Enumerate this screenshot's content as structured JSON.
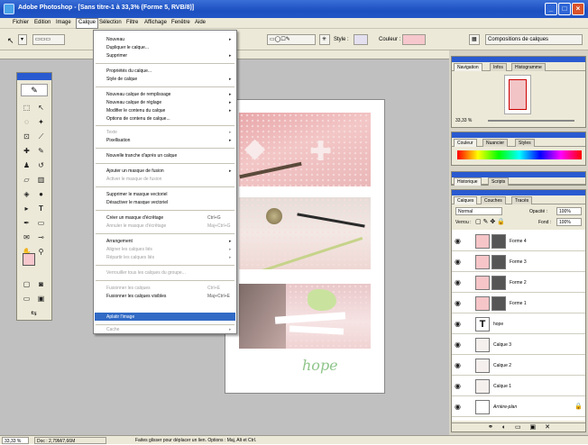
{
  "window": {
    "title": "Adobe Photoshop - [Sans titre-1 à 33,3% (Forme 5, RVB/8)]"
  },
  "window_controls": {
    "minimize": "_",
    "maximize": "□",
    "close": "×"
  },
  "menubar": [
    "Fichier",
    "Edition",
    "Image",
    "Calque",
    "Sélection",
    "Filtre",
    "Affichage",
    "Fenêtre",
    "Aide"
  ],
  "options_bar": {
    "style_label": "Style :",
    "color_label": "Couleur :",
    "layer_comps": "Compositions de calques"
  },
  "layer_menu": {
    "items": [
      {
        "label": "Nouveau",
        "submenu": true
      },
      {
        "label": "Dupliquer le calque...",
        "submenu": false
      },
      {
        "label": "Supprimer",
        "submenu": true
      },
      {
        "label": "Propriétés du calque...",
        "submenu": false
      },
      {
        "label": "Style de calque",
        "submenu": true
      },
      {
        "label": "Nouveau calque de remplissage",
        "submenu": true
      },
      {
        "label": "Nouveau calque de réglage",
        "submenu": true
      },
      {
        "label": "Modifier le contenu du calque",
        "submenu": true
      },
      {
        "label": "Options de contenu de calque...",
        "submenu": false
      },
      {
        "label": "Texte",
        "submenu": true,
        "disabled": true
      },
      {
        "label": "Pixellisation",
        "submenu": true
      },
      {
        "label": "Nouvelle tranche d'après un calque",
        "submenu": false
      },
      {
        "label": "Ajouter un masque de fusion",
        "submenu": true
      },
      {
        "label": "Activer le masque de fusion",
        "submenu": false,
        "disabled": true
      },
      {
        "label": "Supprimer le masque vectoriel",
        "submenu": false
      },
      {
        "label": "Désactiver le masque vectoriel",
        "submenu": false
      },
      {
        "label": "Créer un masque d'écrêtage",
        "shortcut": "Ctrl+G"
      },
      {
        "label": "Annuler le masque d'écrêtage",
        "shortcut": "Maj+Ctrl+G",
        "disabled": true
      },
      {
        "label": "Arrangement",
        "submenu": true
      },
      {
        "label": "Aligner les calques liés",
        "submenu": true,
        "disabled": true
      },
      {
        "label": "Répartir les calques liés",
        "submenu": true,
        "disabled": true
      },
      {
        "label": "Verrouiller tous les calques du groupe...",
        "submenu": false,
        "disabled": true
      },
      {
        "label": "Fusionner les calques",
        "shortcut": "Ctrl+E",
        "disabled": true
      },
      {
        "label": "Fusionner les calques visibles",
        "shortcut": "Maj+Ctrl+E"
      },
      {
        "label": "Aplatir l'image",
        "highlighted": true
      },
      {
        "label": "Cache",
        "submenu": true,
        "disabled": true
      }
    ]
  },
  "document": {
    "scrawl_text": "hope"
  },
  "palettes": {
    "navigator": {
      "tabs": [
        "Navigation",
        "Infos",
        "Histogramme"
      ],
      "zoom": "33,33 %"
    },
    "color": {
      "tabs": [
        "Couleur",
        "Nuancier",
        "Styles"
      ]
    },
    "history": {
      "tabs": [
        "Historique",
        "Scripts"
      ]
    },
    "layers": {
      "tabs": [
        "Calques",
        "Couches",
        "Tracés"
      ],
      "blend_mode": "Normal",
      "opacity_label": "Opacité :",
      "opacity": "100%",
      "lock_label": "Verrou :",
      "fill_label": "Fond :",
      "fill": "100%",
      "rows": [
        {
          "name": "Forme 4",
          "kind": "shape"
        },
        {
          "name": "Forme 3",
          "kind": "shape"
        },
        {
          "name": "Forme 2",
          "kind": "shape"
        },
        {
          "name": "Forme 1",
          "kind": "shape"
        },
        {
          "name": "hope",
          "kind": "text"
        },
        {
          "name": "Calque 3",
          "kind": "raster"
        },
        {
          "name": "Calque 2",
          "kind": "raster"
        },
        {
          "name": "Calque 1",
          "kind": "raster"
        },
        {
          "name": "Arrière-plan",
          "kind": "background"
        }
      ]
    }
  },
  "statusbar": {
    "zoom": "33,33 %",
    "doc": "Doc : 2,79M/7,66M",
    "hint": "Faites glisser pour déplacer un lien. Options : Maj, Alt et Ctrl."
  }
}
